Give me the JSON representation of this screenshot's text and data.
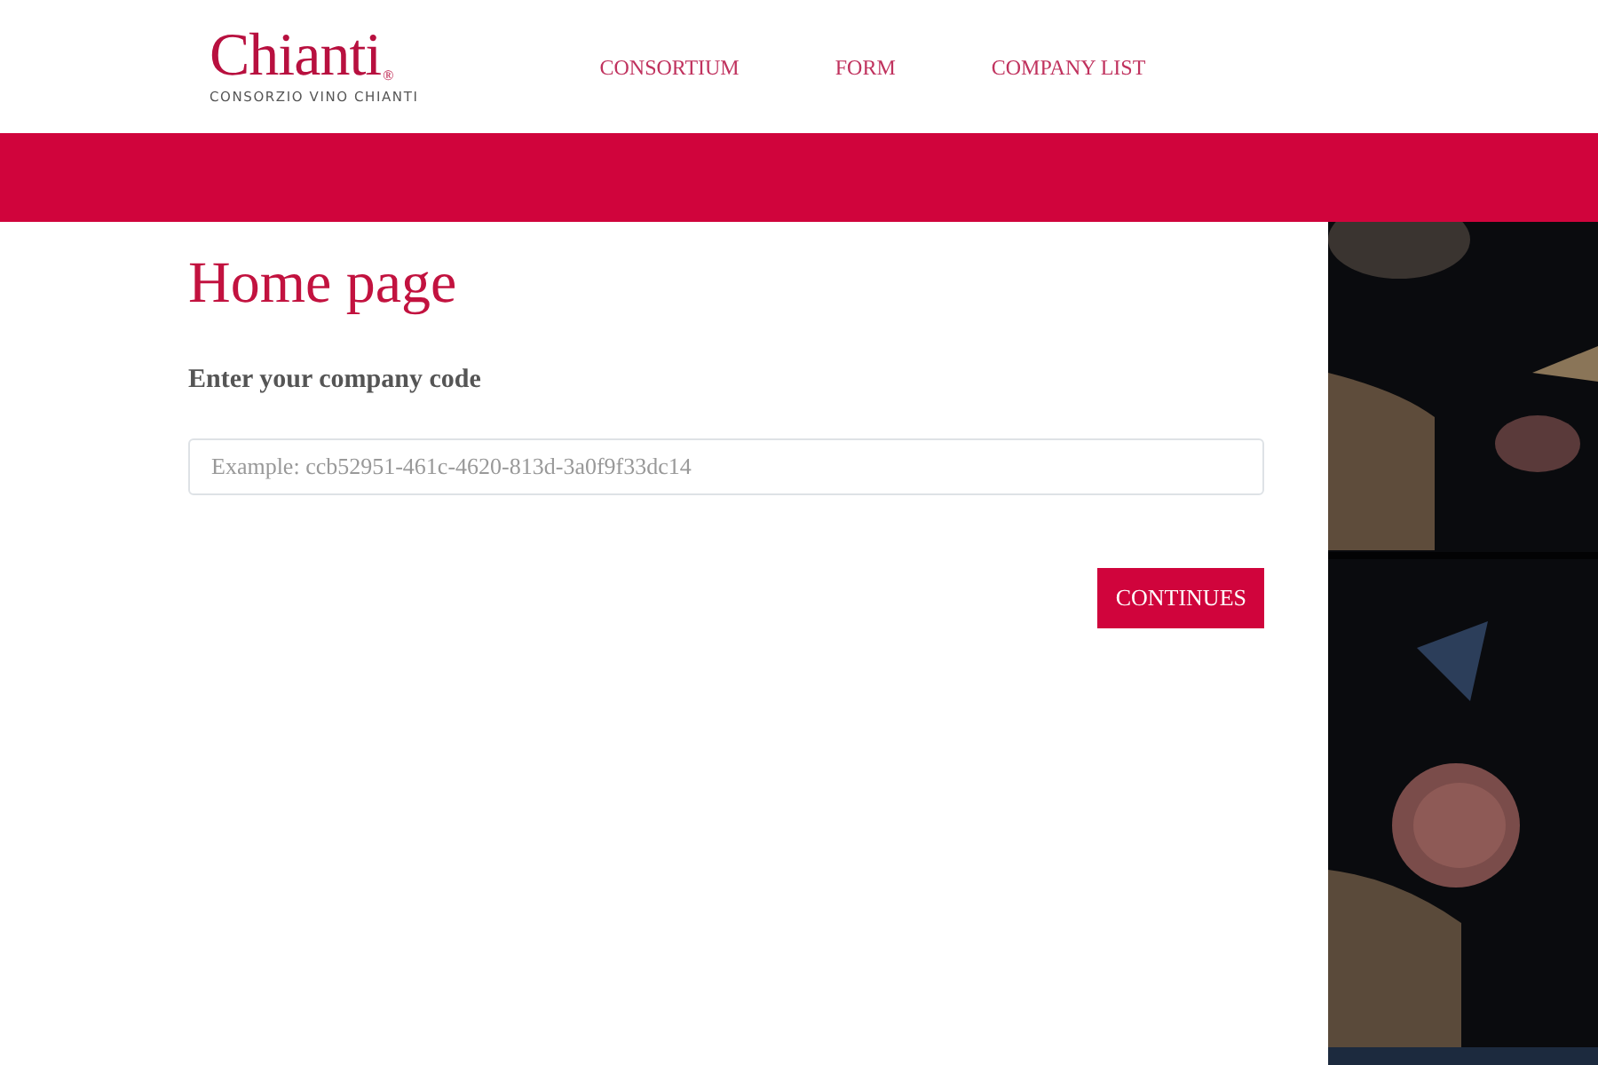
{
  "logo": {
    "name": "Chianti",
    "registered": "®",
    "tagline": "CONSORZIO VINO CHIANTI"
  },
  "nav": [
    "CONSORTIUM",
    "FORM",
    "COMPANY LIST"
  ],
  "heading": "Home page",
  "form": {
    "label": "Enter your company code",
    "placeholder": "Example: ccb52951-461c-4620-813d-3a0f9f33dc14",
    "button": "CONTINUES"
  }
}
